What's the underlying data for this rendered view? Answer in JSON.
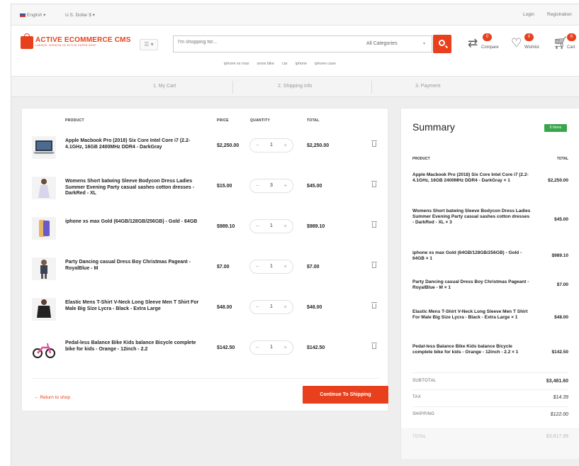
{
  "topbar": {
    "language": "English",
    "currency": "U.S. Dollar $",
    "login": "Login",
    "registration": "Registration"
  },
  "header": {
    "logo_title": "ACTIVE ECOMMERCE CMS",
    "logo_sub": "LARAVEL VERSION OF ACTIVE SUPER SHOP",
    "menu_icon": "grid-icon",
    "search_placeholder": "I'm shopping for...",
    "category_label": "All Categories",
    "compare": {
      "label": "Compare",
      "count": "0"
    },
    "wishlist": {
      "label": "Wishlist",
      "count": "0"
    },
    "cart": {
      "label": "Cart",
      "count": "6"
    }
  },
  "tags": [
    "iphone xs max",
    "snow bike",
    "car",
    "iphone",
    "iphone case"
  ],
  "steps": [
    "1. My Cart",
    "2. Shipping info",
    "3. Payment"
  ],
  "cart": {
    "headers": {
      "product": "PRODUCT",
      "price": "PRICE",
      "quantity": "QUANTITY",
      "total": "TOTAL"
    },
    "items": [
      {
        "name": "Apple Macbook Pro (2018) Six Core Intel Core i7 (2.2-4.1GHz, 16GB 2400MHz DDR4 - DarkGray",
        "price": "$2,250.00",
        "qty": "1",
        "total": "$2,250.00",
        "thumb": "laptop"
      },
      {
        "name": "Womens Short batwing Sleeve Bodycon Dress Ladies Summer Evening Party casual sashes cotton dresses - DarkRed - XL",
        "price": "$15.00",
        "qty": "3",
        "total": "$45.00",
        "thumb": "dress"
      },
      {
        "name": "iphone xs max Gold (64GB/128GB/256GB) - Gold - 64GB",
        "price": "$989.10",
        "qty": "1",
        "total": "$989.10",
        "thumb": "phone"
      },
      {
        "name": "Party Dancing casual Dress Boy Christmas Pageant - RoyalBlue - M",
        "price": "$7.00",
        "qty": "1",
        "total": "$7.00",
        "thumb": "boy"
      },
      {
        "name": "Elastic Mens T-Shirt V-Neck Long Sleeve Men T Shirt For Male Big Size Lycra - Black - Extra Large",
        "price": "$48.00",
        "qty": "1",
        "total": "$48.00",
        "thumb": "tshirt"
      },
      {
        "name": "Pedal-less Balance Bike Kids balance Bicycle complete bike for kids - Orange - 12inch - 2.2",
        "price": "$142.50",
        "qty": "1",
        "total": "$142.50",
        "thumb": "bike"
      }
    ],
    "return_label": "Return to shop",
    "continue_label": "Continue To Shipping"
  },
  "summary": {
    "title": "Summary",
    "badge": "6 Items",
    "headers": {
      "product": "PRODUCT",
      "total": "TOTAL"
    },
    "items": [
      {
        "name": "Apple Macbook Pro (2018) Six Core Intel Core i7 (2.2-4.1GHz, 16GB 2400MHz DDR4 - DarkGray × 1",
        "value": "$2,250.00"
      },
      {
        "name": "Womens Short batwing Sleeve Bodycon Dress Ladies Summer Evening Party casual sashes cotton dresses - DarkRed - XL × 3",
        "value": "$45.00"
      },
      {
        "name": "iphone xs max Gold (64GB/128GB/256GB) - Gold - 64GB × 1",
        "value": "$989.10"
      },
      {
        "name": "Party Dancing casual Dress Boy Christmas Pageant - RoyalBlue - M × 1",
        "value": "$7.00"
      },
      {
        "name": "Elastic Mens T-Shirt V-Neck Long Sleeve Men T Shirt For Male Big Size Lycra - Black - Extra Large × 1",
        "value": "$48.00"
      },
      {
        "name": "Pedal-less Balance Bike Kids balance Bicycle complete bike for kids - Orange - 12inch - 2.2 × 1",
        "value": "$142.50"
      }
    ],
    "subtotal_label": "SUBTOTAL",
    "subtotal": "$3,481.60",
    "tax_label": "TAX",
    "tax": "$14.39",
    "shipping_label": "SHIPPING",
    "shipping": "$122.00",
    "total_label": "TOTAL",
    "total": "$3,617.99"
  },
  "colors": {
    "accent": "#e8401c",
    "badge_green": "#3aa64c"
  }
}
